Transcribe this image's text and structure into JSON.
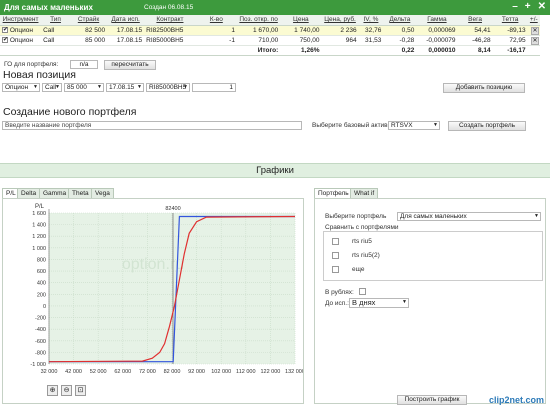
{
  "window": {
    "title": "Для самых маленьких",
    "created": "Создан 06.08.15",
    "controls": [
      "–",
      "+",
      "✕"
    ]
  },
  "positions": {
    "headers": [
      "Инструмент",
      "Тип",
      "Страйк",
      "Дата исп.",
      "Контракт",
      "К-во",
      "Поз. откр. по",
      "Цена",
      "Цена, руб.",
      "IV, %",
      "Дельта",
      "Гамма",
      "Вега",
      "Тетта",
      "+/-"
    ],
    "rows": [
      {
        "checked": "✔",
        "instrument": "Опцион",
        "type": "Call",
        "strike": "82 500",
        "date": "17.08.15",
        "contract": "RI82500BH5",
        "qty": "1",
        "open": "1 670,00",
        "price": "1 740,00",
        "price_rub": "2 236",
        "iv": "32,76",
        "delta": "0,50",
        "gamma": "0,000069",
        "vega": "54,41",
        "theta": "-89,13"
      },
      {
        "checked": "✔",
        "instrument": "Опцион",
        "type": "Call",
        "strike": "85 000",
        "date": "17.08.15",
        "contract": "RI85000BH5",
        "qty": "-1",
        "open": "710,00",
        "price": "750,00",
        "price_rub": "964",
        "iv": "31,53",
        "delta": "-0,28",
        "gamma": "-0,000079",
        "vega": "-46,28",
        "theta": "72,95"
      }
    ],
    "total": {
      "label": "Итого:",
      "pct": "1,26%",
      "delta": "0,22",
      "gamma": "0,000010",
      "vega": "8,14",
      "theta": "-16,17"
    }
  },
  "go": {
    "label": "ГО для портфеля:",
    "value": "n/a",
    "recalc": "пересчитать"
  },
  "new_position": {
    "title": "Новая позиция",
    "instrument": "Опцион",
    "type": "Call",
    "strike": "85 000",
    "date": "17.08.15",
    "contract": "RI85000BH5",
    "qty": "1",
    "add": "Добавить позицию"
  },
  "new_portfolio": {
    "title": "Создание нового портфеля",
    "placeholder": "Введите название портфеля",
    "base_label": "Выберите базовый актив",
    "base_value": "RTSVX",
    "create": "Создать портфель"
  },
  "graphs": {
    "title": "Графики",
    "tabs": [
      "P/L",
      "Delta",
      "Gamma",
      "Theta",
      "Vega"
    ],
    "right_tabs": [
      "Портфель",
      "What if"
    ],
    "portfolio_label": "Выберите портфель",
    "portfolio_value": "Для самых маленьких",
    "compare_label": "Сравнить с портфелями",
    "compare_items": [
      "rts riu5",
      "rts riu5(2)",
      "еще"
    ],
    "rub_label": "В рублях:",
    "until_label": "До исп.:",
    "until_value": "В днях",
    "build": "Построить график",
    "watermark": "option.ru",
    "zoom_icons": [
      "⊕",
      "⊖",
      "⊡"
    ]
  },
  "chart_data": {
    "type": "line",
    "ylabel": "P/L",
    "marker": "82400",
    "x_ticks": [
      "32 000",
      "42 000",
      "52 000",
      "62 000",
      "72 000",
      "82 000",
      "92 000",
      "102 000",
      "112 000",
      "122 000",
      "132 000"
    ],
    "xlim": [
      32000,
      132000
    ],
    "y_ticks": [
      "1 600",
      "1 400",
      "1 200",
      "1 000",
      "800",
      "600",
      "400",
      "200",
      "0",
      "-200",
      "-400",
      "-600",
      "-800",
      "-1 000"
    ],
    "ylim": [
      -1000,
      1600
    ],
    "series": [
      {
        "color": "#3355dd",
        "x": [
          32000,
          82500,
          85000,
          132000
        ],
        "y": [
          -960,
          -960,
          1540,
          1540
        ]
      },
      {
        "color": "#e03030",
        "x": [
          32000,
          70000,
          74000,
          77000,
          79000,
          81000,
          83000,
          85000,
          87000,
          89000,
          92000,
          96000,
          132000
        ],
        "y": [
          -960,
          -950,
          -900,
          -800,
          -650,
          -350,
          0,
          450,
          900,
          1250,
          1450,
          1530,
          1540
        ]
      }
    ]
  },
  "brand": "clip2net.com"
}
